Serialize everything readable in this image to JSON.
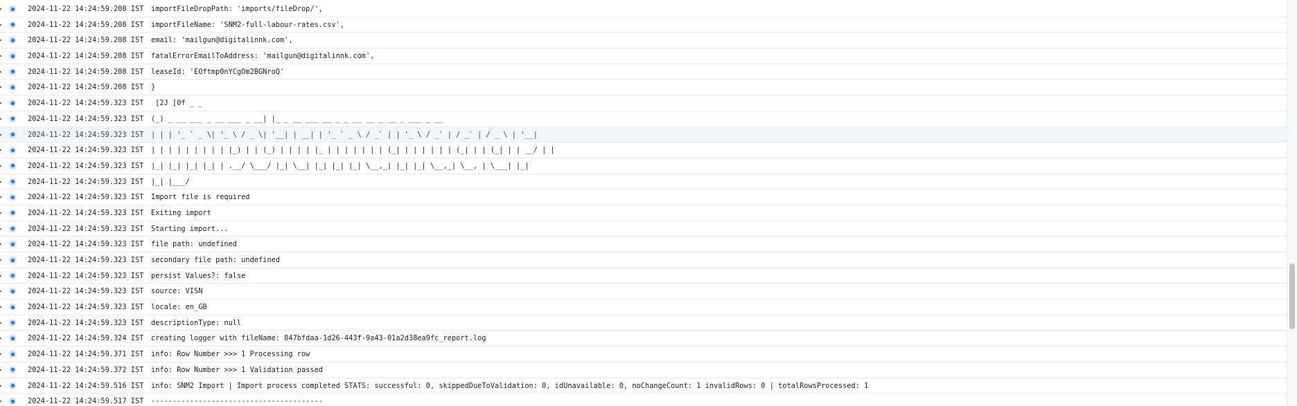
{
  "log_entries": [
    {
      "timestamp": "2024-11-22 14:24:59.208 IST",
      "message": "importFileDropPath: 'imports/fileDrop/',"
    },
    {
      "timestamp": "2024-11-22 14:24:59.208 IST",
      "message": "importFileName: 'SNM2-full-labour-rates.csv',"
    },
    {
      "timestamp": "2024-11-22 14:24:59.208 IST",
      "message": "email: 'mailgun@digitalinnk.com',"
    },
    {
      "timestamp": "2024-11-22 14:24:59.208 IST",
      "message": "fatalErrorEmailToAddress: 'mailgun@digitalinnk.com',"
    },
    {
      "timestamp": "2024-11-22 14:24:59.208 IST",
      "message": "leaseId: 'EOftmp0nYCgOm2BGNroQ'"
    },
    {
      "timestamp": "2024-11-22 14:24:59.208 IST",
      "message": "}"
    },
    {
      "timestamp": "2024-11-22 14:24:59.323 IST",
      "message": " [2J [0f _ _"
    },
    {
      "timestamp": "2024-11-22 14:24:59.323 IST",
      "message": "(_) _ __ ___ _ __ ___ _ __| |_ _ __ ___ __ _ _ __ __ _ __ _ ___ _ __"
    },
    {
      "timestamp": "2024-11-22 14:24:59.323 IST",
      "message": "| | | '_ ` _ \\| '_ \\ / _ \\| '__| | __| | '_ ` _ \\ / _` | | '_ \\ / _` | / _` | / _ \\ | '__|"
    },
    {
      "timestamp": "2024-11-22 14:24:59.323 IST",
      "message": "| | | | | | | | | |_) | | (_) | | | | |_ | | | | | | | (_| | | | | | | (_| | | (_| | | __/ | |"
    },
    {
      "timestamp": "2024-11-22 14:24:59.323 IST",
      "message": "|_| |_| |_| |_| | .__/ \\___/ |_| \\__| |_| |_| |_| \\__,_| |_| |_| \\__,_| \\__, | \\___| |_|"
    },
    {
      "timestamp": "2024-11-22 14:24:59.323 IST",
      "message": "|_| |___/"
    },
    {
      "timestamp": "2024-11-22 14:24:59.323 IST",
      "message": "Import file is required"
    },
    {
      "timestamp": "2024-11-22 14:24:59.323 IST",
      "message": "Exiting import"
    },
    {
      "timestamp": "2024-11-22 14:24:59.323 IST",
      "message": "Starting import..."
    },
    {
      "timestamp": "2024-11-22 14:24:59.323 IST",
      "message": "file path: undefined"
    },
    {
      "timestamp": "2024-11-22 14:24:59.323 IST",
      "message": "secondary file path: undefined"
    },
    {
      "timestamp": "2024-11-22 14:24:59.323 IST",
      "message": "persist Values?: false"
    },
    {
      "timestamp": "2024-11-22 14:24:59.323 IST",
      "message": "source: VISN"
    },
    {
      "timestamp": "2024-11-22 14:24:59.323 IST",
      "message": "locale: en_GB"
    },
    {
      "timestamp": "2024-11-22 14:24:59.323 IST",
      "message": "descriptionType: null"
    },
    {
      "timestamp": "2024-11-22 14:24:59.324 IST",
      "message": "creating logger with fileName: 847bfdaa-1d26-443f-9a43-01a2d38ea9fc_report.log"
    },
    {
      "timestamp": "2024-11-22 14:24:59.371 IST",
      "message": "info: Row Number >>> 1 Processing row"
    },
    {
      "timestamp": "2024-11-22 14:24:59.372 IST",
      "message": "info: Row Number >>> 1 Validation passed"
    },
    {
      "timestamp": "2024-11-22 14:24:59.516 IST",
      "message": "info: SNM2 Import | Import process completed STATS: successful: 0, skippedDueToValidation: 0, idUnavailable: 0, noChangeCount: 1 invalidRows: 0 | totalRowsProcessed: 1"
    },
    {
      "timestamp": "2024-11-22 14:24:59.517 IST",
      "message": "----------------------------------------"
    }
  ],
  "highlighted_row_index": 8,
  "colors": {
    "severity_info": "#1a73e8",
    "row_highlight": "#f1f6fd",
    "row_divider": "#e8eaed",
    "text": "#202124"
  },
  "icons": {
    "severity": "severity-info-icon"
  }
}
